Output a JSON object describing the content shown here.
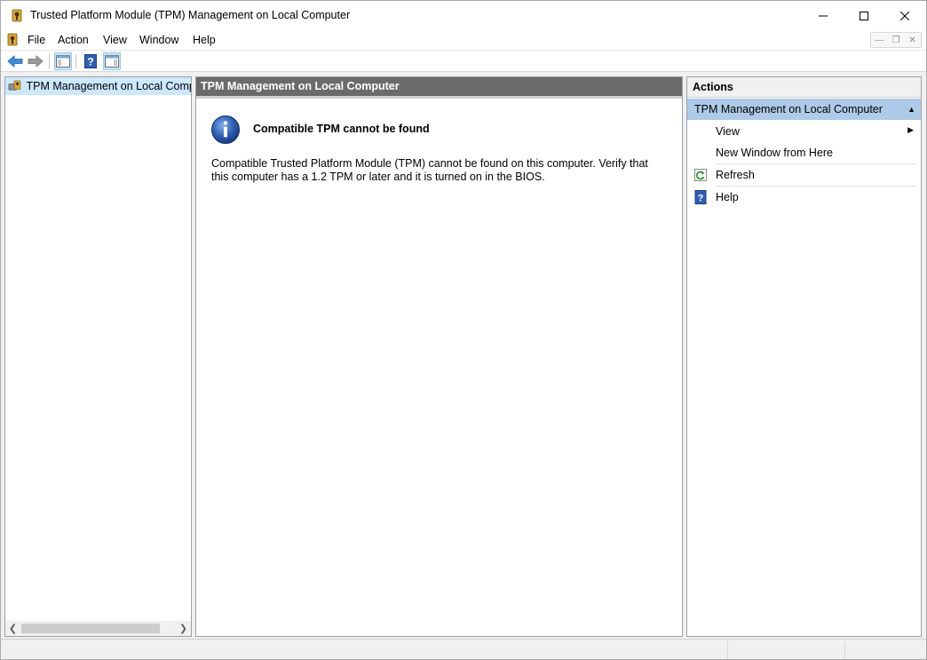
{
  "window": {
    "title": "Trusted Platform Module (TPM) Management on Local Computer"
  },
  "menu": {
    "items": [
      "File",
      "Action",
      "View",
      "Window",
      "Help"
    ]
  },
  "toolbar": {
    "icons": [
      "back-arrow-icon",
      "forward-arrow-icon",
      "show-hide-console-tree-icon",
      "help-icon",
      "show-hide-action-pane-icon"
    ]
  },
  "tree": {
    "root_label": "TPM Management on Local Computer"
  },
  "center": {
    "header": "TPM Management on Local Computer",
    "message_title": "Compatible TPM cannot be found",
    "message_body": "Compatible Trusted Platform Module (TPM) cannot be found on this computer. Verify that this computer has a 1.2 TPM or later and it is turned on in the BIOS."
  },
  "actions": {
    "header": "Actions",
    "section_title": "TPM Management on Local Computer",
    "items": [
      {
        "label": "View",
        "icon": "",
        "submenu": true
      },
      {
        "label": "New Window from Here",
        "icon": "",
        "submenu": false
      },
      {
        "label": "Refresh",
        "icon": "refresh-icon",
        "submenu": false
      },
      {
        "label": "Help",
        "icon": "help-icon",
        "submenu": false
      }
    ]
  },
  "colors": {
    "selected_tree_row": "#cce8ff",
    "center_header_bg": "#6b6b6b",
    "actions_section_bg": "#adcbe8",
    "info_icon_blue": "#2d5fb3"
  }
}
